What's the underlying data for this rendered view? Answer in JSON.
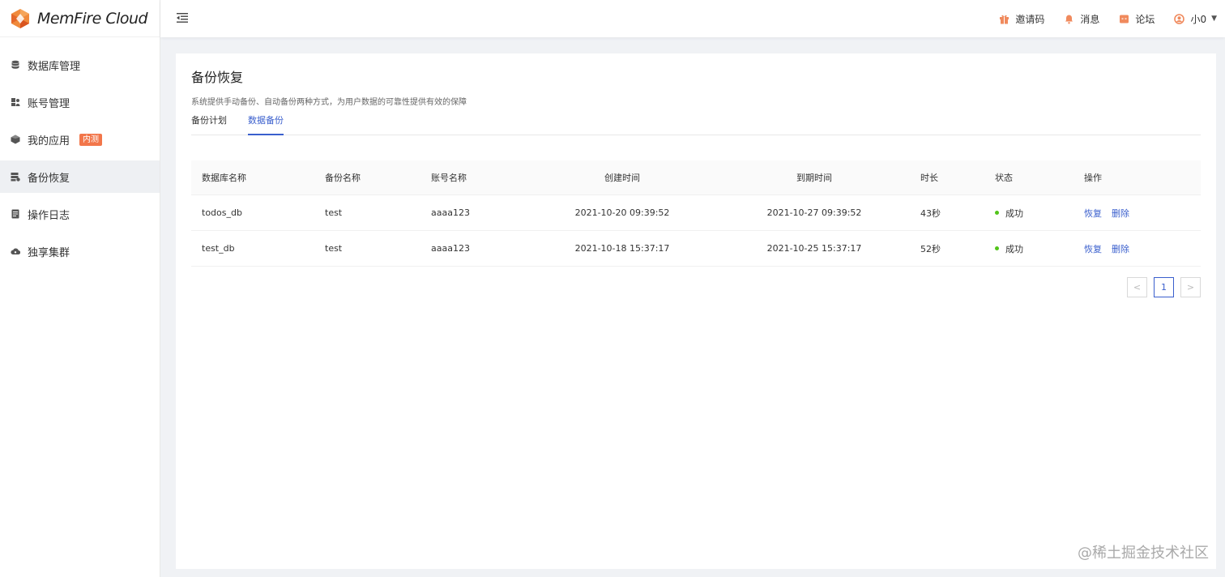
{
  "app": {
    "name": "MemFire Cloud"
  },
  "sidebar": {
    "items": [
      {
        "label": "数据库管理",
        "icon": "database-icon"
      },
      {
        "label": "账号管理",
        "icon": "users-icon"
      },
      {
        "label": "我的应用",
        "icon": "cube-icon",
        "badge": "内测"
      },
      {
        "label": "备份恢复",
        "icon": "backup-icon",
        "active": true
      },
      {
        "label": "操作日志",
        "icon": "document-icon"
      },
      {
        "label": "独享集群",
        "icon": "cloud-icon"
      }
    ]
  },
  "topbar": {
    "invite": "邀请码",
    "messages": "消息",
    "forum": "论坛",
    "user": "小0"
  },
  "page": {
    "title": "备份恢复",
    "description": "系统提供手动备份、自动备份两种方式，为用户数据的可靠性提供有效的保障",
    "tabs": [
      {
        "label": "备份计划",
        "active": false
      },
      {
        "label": "数据备份",
        "active": true
      }
    ]
  },
  "table": {
    "headers": [
      "数据库名称",
      "备份名称",
      "账号名称",
      "创建时间",
      "到期时间",
      "时长",
      "状态",
      "操作"
    ],
    "rows": [
      {
        "db": "todos_db",
        "backup": "test",
        "account": "aaaa123",
        "created": "2021-10-20 09:39:52",
        "expires": "2021-10-27 09:39:52",
        "duration": "43秒",
        "status": "成功",
        "restore": "恢复",
        "delete": "删除"
      },
      {
        "db": "test_db",
        "backup": "test",
        "account": "aaaa123",
        "created": "2021-10-18 15:37:17",
        "expires": "2021-10-25 15:37:17",
        "duration": "52秒",
        "status": "成功",
        "restore": "恢复",
        "delete": "删除"
      }
    ]
  },
  "pagination": {
    "prev": "<",
    "current": "1",
    "next": ">"
  },
  "watermark": "@稀土掘金技术社区",
  "colors": {
    "accent": "#3a5fcd",
    "badge": "#f2764a",
    "success": "#52c41a",
    "topIcon": "#f08a5d"
  }
}
